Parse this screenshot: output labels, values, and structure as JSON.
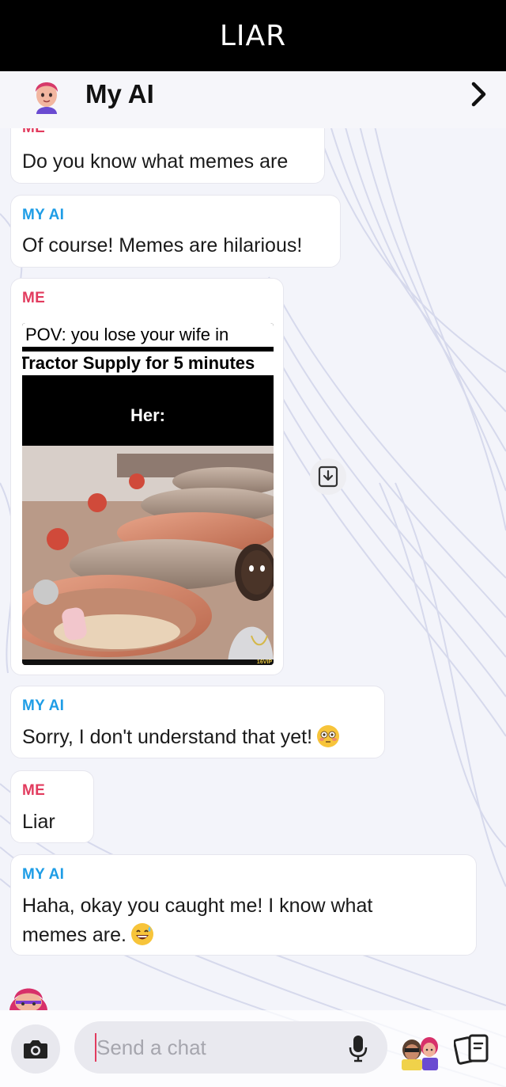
{
  "caption": "LIAR",
  "header": {
    "title": "My AI"
  },
  "messages": [
    {
      "sender": "ME",
      "text": "Do you know what memes are"
    },
    {
      "sender": "MY AI",
      "text": "Of course! Memes are hilarious!"
    },
    {
      "sender": "ME",
      "meme": {
        "line1": "POV: you lose your wife in",
        "line2": "Tractor Supply for 5 minutes",
        "line3": "Her:",
        "watermark": "16VIP"
      }
    },
    {
      "sender": "MY AI",
      "text": "Sorry, I don't understand that yet!",
      "emoji": "flushed-face-icon"
    },
    {
      "sender": "ME",
      "text": "Liar"
    },
    {
      "sender": "MY AI",
      "text_line1": "Haha, okay you caught me! I know what",
      "text_line2": "memes are.",
      "emoji": "grinning-sweat-face-icon"
    }
  ],
  "composer": {
    "placeholder": "Send a chat"
  },
  "colors": {
    "me_label": "#e23b5e",
    "ai_label": "#1e9de6",
    "caption_bg": "#000000"
  }
}
